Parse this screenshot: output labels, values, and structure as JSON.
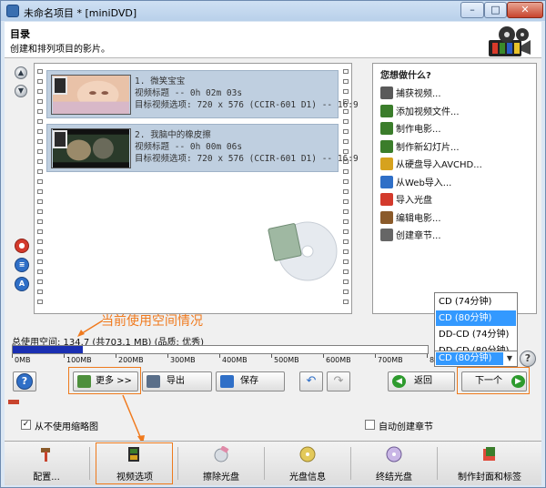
{
  "window": {
    "title": "未命名项目 * [miniDVD]",
    "controls": {
      "minimize": "–",
      "maximize": "□",
      "close": "✕"
    }
  },
  "header": {
    "title": "目录",
    "subtitle": "创建和排列项目的影片。",
    "logo_icon": "film-reel-icon"
  },
  "nav": {
    "up_icon": "arrow-up-icon",
    "down_icon": "arrow-down-icon"
  },
  "side_buttons": [
    {
      "name": "record-icon",
      "color": "#d33a2c",
      "glyph": "●"
    },
    {
      "name": "convert-icon",
      "color": "#2f6fc7",
      "glyph": "≡"
    },
    {
      "name": "auto-icon",
      "color": "#2f6fc7",
      "glyph": "A"
    }
  ],
  "clips": [
    {
      "index": "1.",
      "name": "微笑宝宝",
      "video_title_label": "视频标题 -- 0h 02m 03s",
      "target_label": "目标视频选项: 720 x 576 (CCIR-601 D1) -- 16:9"
    },
    {
      "index": "2.",
      "name": "我脑中的橡皮擦",
      "video_title_label": "视频标题 -- 0h 00m 06s",
      "target_label": "目标视频选项: 720 x 576 (CCIR-601 D1) -- 16:9"
    }
  ],
  "tasks": {
    "title": "您想做什么?",
    "items": [
      {
        "label": "捕获视频...",
        "icon": "capture-video-icon",
        "color": "#5a5a5a"
      },
      {
        "label": "添加视频文件...",
        "icon": "add-video-file-icon",
        "color": "#3b7d2b"
      },
      {
        "label": "制作电影...",
        "icon": "make-movie-icon",
        "color": "#3b7d2b"
      },
      {
        "label": "制作新幻灯片...",
        "icon": "new-slideshow-icon",
        "color": "#3b7d2b"
      },
      {
        "label": "从硬盘导入AVCHD...",
        "icon": "import-avchd-icon",
        "color": "#d6a21e"
      },
      {
        "label": "从Web导入...",
        "icon": "web-import-icon",
        "color": "#2f6fc7"
      },
      {
        "label": "导入光盘",
        "icon": "import-disc-icon",
        "color": "#d33a2c"
      },
      {
        "label": "编辑电影...",
        "icon": "edit-movie-icon",
        "color": "#8a5a2a"
      },
      {
        "label": "创建章节...",
        "icon": "create-chapters-icon",
        "color": "#666666"
      }
    ]
  },
  "disc_dropdown": {
    "options": [
      "CD (74分钟)",
      "CD (80分钟)",
      "DD-CD (74分钟)",
      "DD-CD (80分钟)"
    ],
    "selected_index": 1,
    "selected": "CD (80分钟)"
  },
  "annotation": {
    "text": "当前使用空间情况",
    "color": "#f07a1e"
  },
  "usage": {
    "label": "总使用空间: 134.7 (共703.1 MB) (品质: 优秀)",
    "used_mb": 134.7,
    "capacity_mb": 703.1,
    "ruler_labels": [
      "0MB",
      "100MB",
      "200MB",
      "300MB",
      "400MB",
      "500MB",
      "600MB",
      "700MB",
      "800MB"
    ],
    "bar_color": "#1a2fb2"
  },
  "toolbar": {
    "help_glyph": "?",
    "more": "更多 >>",
    "export": "导出",
    "save": "保存",
    "undo_icon": "undo-icon",
    "redo_icon": "redo-icon",
    "back": "返回",
    "next": "下一个"
  },
  "options": {
    "never_thumbnails": "从不使用缩略图",
    "never_thumbnails_checked": "✓",
    "auto_chapters": "自动创建章节"
  },
  "bottombar": {
    "items": [
      {
        "label": "配置...",
        "icon": "configure-hammer-icon"
      },
      {
        "label": "视频选项",
        "icon": "video-options-icon"
      },
      {
        "label": "擦除光盘",
        "icon": "erase-disc-icon"
      },
      {
        "label": "光盘信息",
        "icon": "disc-info-icon"
      },
      {
        "label": "终结光盘",
        "icon": "finalize-disc-icon"
      },
      {
        "label": "制作封面和标签",
        "icon": "cover-label-icon"
      }
    ]
  },
  "colors": {
    "accent": "#3399ff",
    "annotation": "#f07a1e",
    "next_button": "#2e9b2e"
  }
}
